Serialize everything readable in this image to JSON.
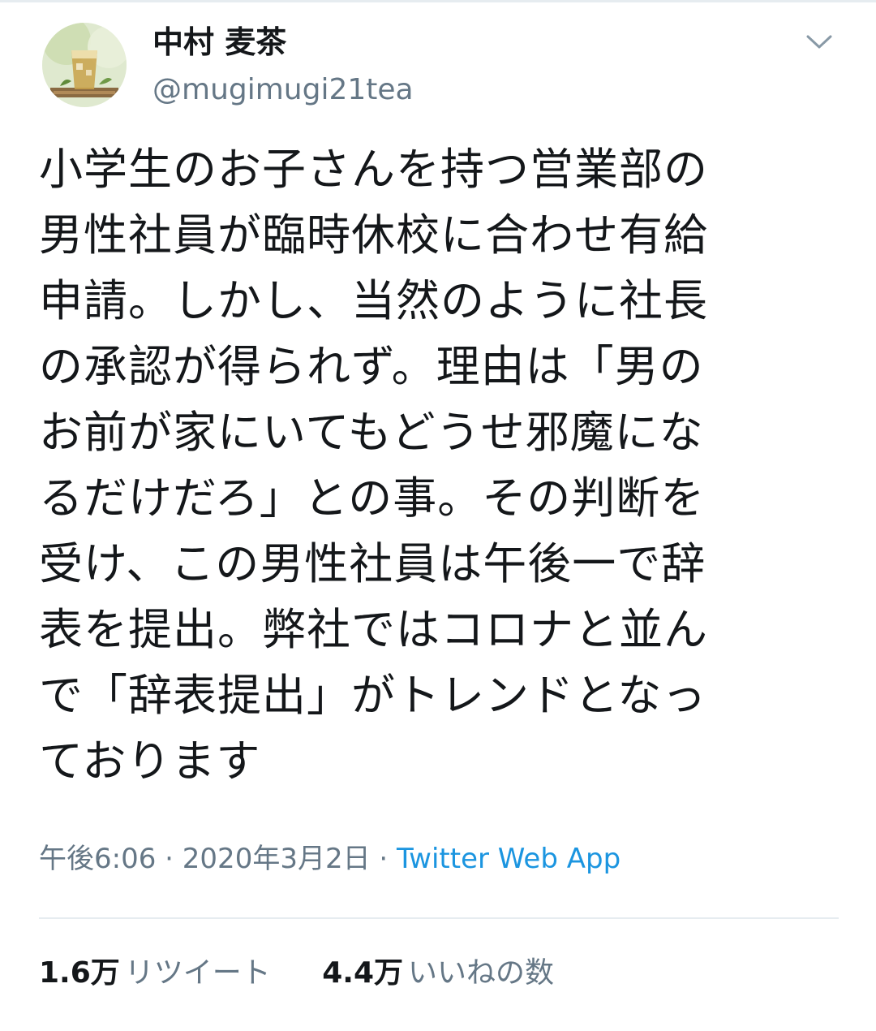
{
  "user": {
    "display_name": "中村 麦茶",
    "handle": "@mugimugi21tea",
    "avatar_icon": "iced-tea-avatar"
  },
  "menu": {
    "icon": "chevron-down-icon"
  },
  "tweet": {
    "text": "小学生のお子さんを持つ営業部の\n男性社員が臨時休校に合わせ有給\n申請。しかし、当然のように社長\nの承認が得られず。理由は「男の\nお前が家にいてもどうせ邪魔にな\nるだけだろ」との事。その判断を\n受け、この男性社員は午後一で辞\n表を提出。弊社ではコロナと並ん\nで「辞表提出」がトレンドとなっ\nております"
  },
  "meta": {
    "time": "午後6:06",
    "separator": "·",
    "date": "2020年3月2日",
    "source": "Twitter Web App"
  },
  "stats": {
    "retweets_count": "1.6万",
    "retweets_label": "リツイート",
    "likes_count": "4.4万",
    "likes_label": "いいねの数"
  },
  "colors": {
    "link": "#1b95e0",
    "secondary_text": "#657786",
    "primary_text": "#14171a",
    "divider": "#e6ecf0"
  }
}
